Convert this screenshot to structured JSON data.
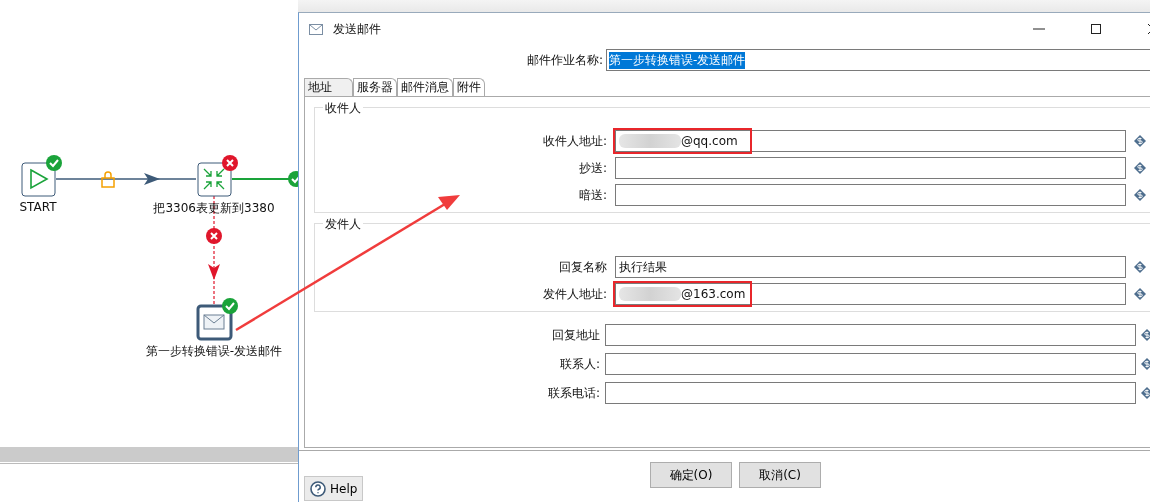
{
  "canvas": {
    "nodes": [
      {
        "label": "START",
        "kind": "start",
        "succeeded": true
      },
      {
        "label": "把3306表更新到3380",
        "kind": "transform",
        "succeeded": false
      },
      {
        "label": "第一步转换错误-发送邮件",
        "kind": "mail",
        "succeeded": true
      }
    ],
    "hops": [
      {
        "kind": "unconditional"
      },
      {
        "kind": "success"
      },
      {
        "kind": "error"
      }
    ],
    "annotation_arrow": true
  },
  "dialog": {
    "title": "发送邮件",
    "job_name": {
      "label": "邮件作业名称:",
      "value": "第一步转换错误-发送邮件",
      "selected": true
    },
    "tabs": [
      {
        "label": "地址",
        "selected": true
      },
      {
        "label": "服务器",
        "selected": false
      },
      {
        "label": "邮件消息",
        "selected": false
      },
      {
        "label": "附件",
        "selected": false
      }
    ],
    "groups": [
      {
        "title": "收件人",
        "fields": [
          {
            "label": "收件人地址:",
            "value": "@qq.com",
            "redacted": true,
            "highlighted": true
          },
          {
            "label": "抄送:",
            "highlighted": false
          },
          {
            "label": "暗送:",
            "highlighted": false
          }
        ]
      },
      {
        "title": "发件人",
        "fields": [
          {
            "label": "回复名称",
            "value": "执行结果",
            "highlighted": false
          },
          {
            "label": "发件人地址:",
            "value": "@163.com",
            "redacted": true,
            "highlighted": true
          }
        ]
      }
    ],
    "fields": [
      {
        "label": "回复地址"
      },
      {
        "label": "联系人:"
      },
      {
        "label": "联系电话:"
      }
    ],
    "buttons": [
      {
        "label": "确定(O)"
      },
      {
        "label": "取消(C)"
      }
    ],
    "help_button": {
      "label": "Help"
    }
  }
}
